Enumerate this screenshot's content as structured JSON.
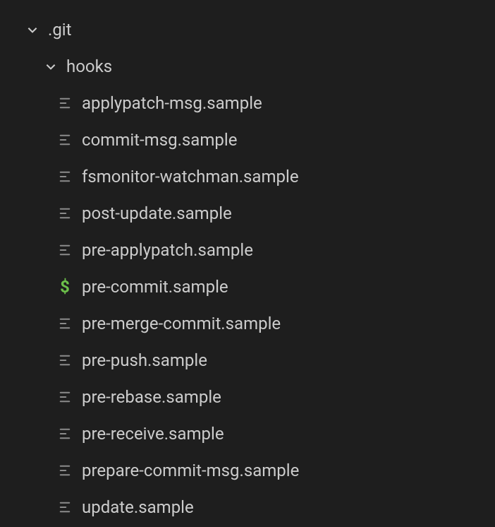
{
  "tree": {
    "root_folder": {
      "label": ".git",
      "expanded": true
    },
    "sub_folder": {
      "label": "hooks",
      "expanded": true
    },
    "files": [
      {
        "label": "applypatch-msg.sample",
        "icon": "text"
      },
      {
        "label": "commit-msg.sample",
        "icon": "text"
      },
      {
        "label": "fsmonitor-watchman.sample",
        "icon": "text"
      },
      {
        "label": "post-update.sample",
        "icon": "text"
      },
      {
        "label": "pre-applypatch.sample",
        "icon": "text"
      },
      {
        "label": "pre-commit.sample",
        "icon": "shell"
      },
      {
        "label": "pre-merge-commit.sample",
        "icon": "text"
      },
      {
        "label": "pre-push.sample",
        "icon": "text"
      },
      {
        "label": "pre-rebase.sample",
        "icon": "text"
      },
      {
        "label": "pre-receive.sample",
        "icon": "text"
      },
      {
        "label": "prepare-commit-msg.sample",
        "icon": "text"
      },
      {
        "label": "update.sample",
        "icon": "text"
      }
    ]
  },
  "icons": {
    "shell_symbol": "$"
  }
}
